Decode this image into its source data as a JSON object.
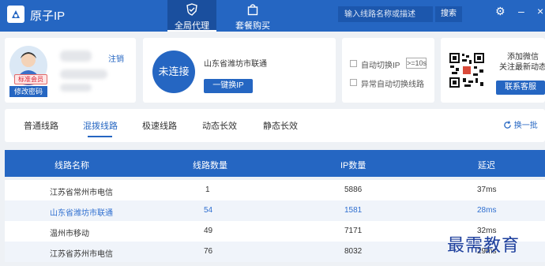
{
  "app": {
    "title": "原子IP"
  },
  "nav": [
    {
      "label": "全局代理",
      "icon": "shield-icon",
      "active": true
    },
    {
      "label": "套餐购买",
      "icon": "shopping-bag-icon",
      "active": false
    }
  ],
  "search": {
    "placeholder": "输入线路名称或描述",
    "button": "搜索"
  },
  "window": {
    "settings_icon": "⚙",
    "minimize_icon": "–",
    "close_icon": "×"
  },
  "user": {
    "badge": "标准会员",
    "change_password": "修改密码",
    "logout": "注销"
  },
  "connection": {
    "status": "未连接",
    "location": "山东省潍坊市联通",
    "switch_button": "一键换IP"
  },
  "options": {
    "auto_switch_label": "自动切换IP",
    "auto_switch_value": ">=10s",
    "abnormal_switch_label": "异常自动切换线路"
  },
  "wechat": {
    "line1": "添加微信",
    "line2": "关注最新动态",
    "support_button": "联系客服"
  },
  "line_tabs": [
    "普通线路",
    "混拨线路",
    "极速线路",
    "动态长效",
    "静态长效"
  ],
  "active_line_tab": 1,
  "refresh": {
    "label": "换一批"
  },
  "table": {
    "headers": [
      "线路名称",
      "线路数量",
      "IP数量",
      "延迟"
    ],
    "rows": [
      {
        "name": "江苏省常州市电信",
        "count": "1",
        "ips": "5886",
        "latency": "37ms"
      },
      {
        "name": "山东省潍坊市联通",
        "count": "54",
        "ips": "1581",
        "latency": "28ms"
      },
      {
        "name": "温州市移动",
        "count": "49",
        "ips": "7171",
        "latency": "32ms"
      },
      {
        "name": "江苏省苏州市电信",
        "count": "76",
        "ips": "8032",
        "latency": "29ms"
      }
    ]
  },
  "watermark": "最需教育",
  "colors": {
    "primary": "#2566c2",
    "highlight_text": "#2f6fd0",
    "watermark": "#1c3e9c"
  }
}
